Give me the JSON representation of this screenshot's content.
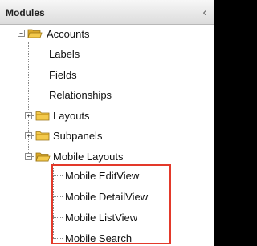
{
  "panel": {
    "title": "Modules",
    "collapse_icon": "chevron-left-icon"
  },
  "tree": {
    "root": {
      "label": "Accounts",
      "expanded": true,
      "children": [
        {
          "label": "Labels",
          "type": "leaf"
        },
        {
          "label": "Fields",
          "type": "leaf"
        },
        {
          "label": "Relationships",
          "type": "leaf"
        },
        {
          "label": "Layouts",
          "type": "folder",
          "expanded": false
        },
        {
          "label": "Subpanels",
          "type": "folder",
          "expanded": false
        },
        {
          "label": "Mobile Layouts",
          "type": "folder",
          "expanded": true,
          "children": [
            {
              "label": "Mobile EditView"
            },
            {
              "label": "Mobile DetailView"
            },
            {
              "label": "Mobile ListView"
            },
            {
              "label": "Mobile Search"
            }
          ]
        }
      ]
    }
  },
  "colors": {
    "highlight_border": "#e3392a",
    "folder_fill": "#f3c94c"
  }
}
